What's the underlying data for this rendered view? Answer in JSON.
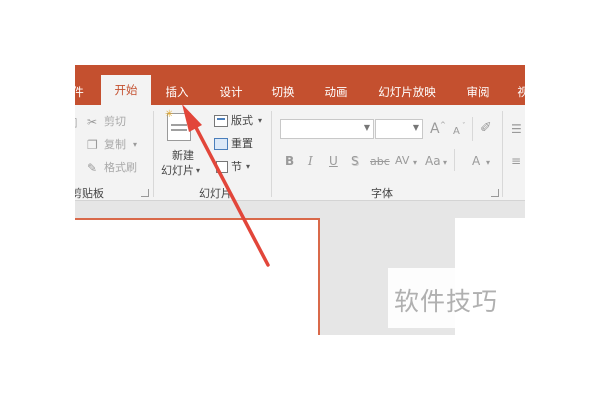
{
  "tabs": [
    {
      "label": "件",
      "active": false
    },
    {
      "label": "开始",
      "active": true
    },
    {
      "label": "插入",
      "active": false
    },
    {
      "label": "设计",
      "active": false
    },
    {
      "label": "切换",
      "active": false
    },
    {
      "label": "动画",
      "active": false
    },
    {
      "label": "幻灯片放映",
      "active": false
    },
    {
      "label": "审阅",
      "active": false
    },
    {
      "label": "视",
      "active": false
    }
  ],
  "clipboard": {
    "cut": "剪切",
    "copy": "复制",
    "painter": "格式刷",
    "group_label": "剪贴板"
  },
  "slides": {
    "new_slide_line1": "新建",
    "new_slide_line2": "幻灯片",
    "layout": "版式",
    "reset": "重置",
    "section": "节",
    "group_label": "幻灯片"
  },
  "font": {
    "group_label": "字体",
    "bold": "B",
    "italic": "I",
    "underline": "U",
    "shadow": "S",
    "strike": "abc",
    "spacing": "AV",
    "case": "Aa",
    "color": "A",
    "grow": "A",
    "shrink": "A"
  },
  "watermark": "软件技巧",
  "colors": {
    "accent": "#c4502f",
    "ribbon_bg": "#f3f3f3",
    "arrow": "#e2463a"
  }
}
